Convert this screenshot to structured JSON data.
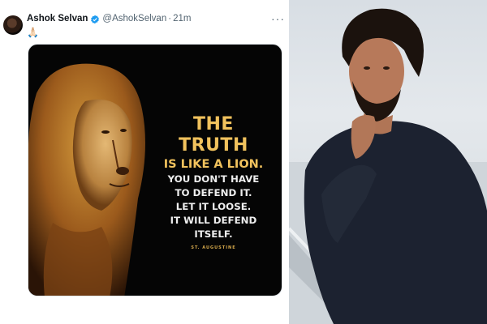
{
  "tweet": {
    "author_name": "Ashok Selvan",
    "handle": "@AshokSelvan",
    "separator": "·",
    "time": "21m",
    "more_label": "···",
    "body_emoji": "🙏🏻",
    "image": {
      "line1": "THE TRUTH",
      "line2": "IS LIKE A LION.",
      "line3": "YOU DON'T HAVE",
      "line4": "TO DEFEND IT.",
      "line5": "LET IT LOOSE.",
      "line6": "IT WILL DEFEND ITSELF.",
      "attribution": "ST. AUGUSTINE"
    }
  },
  "colors": {
    "verified": "#1d9bf0",
    "quote_gold": "#f1c25d",
    "handle_gray": "#536471"
  },
  "icons": {
    "verified": "verified-badge-icon",
    "more": "more-options-icon"
  }
}
